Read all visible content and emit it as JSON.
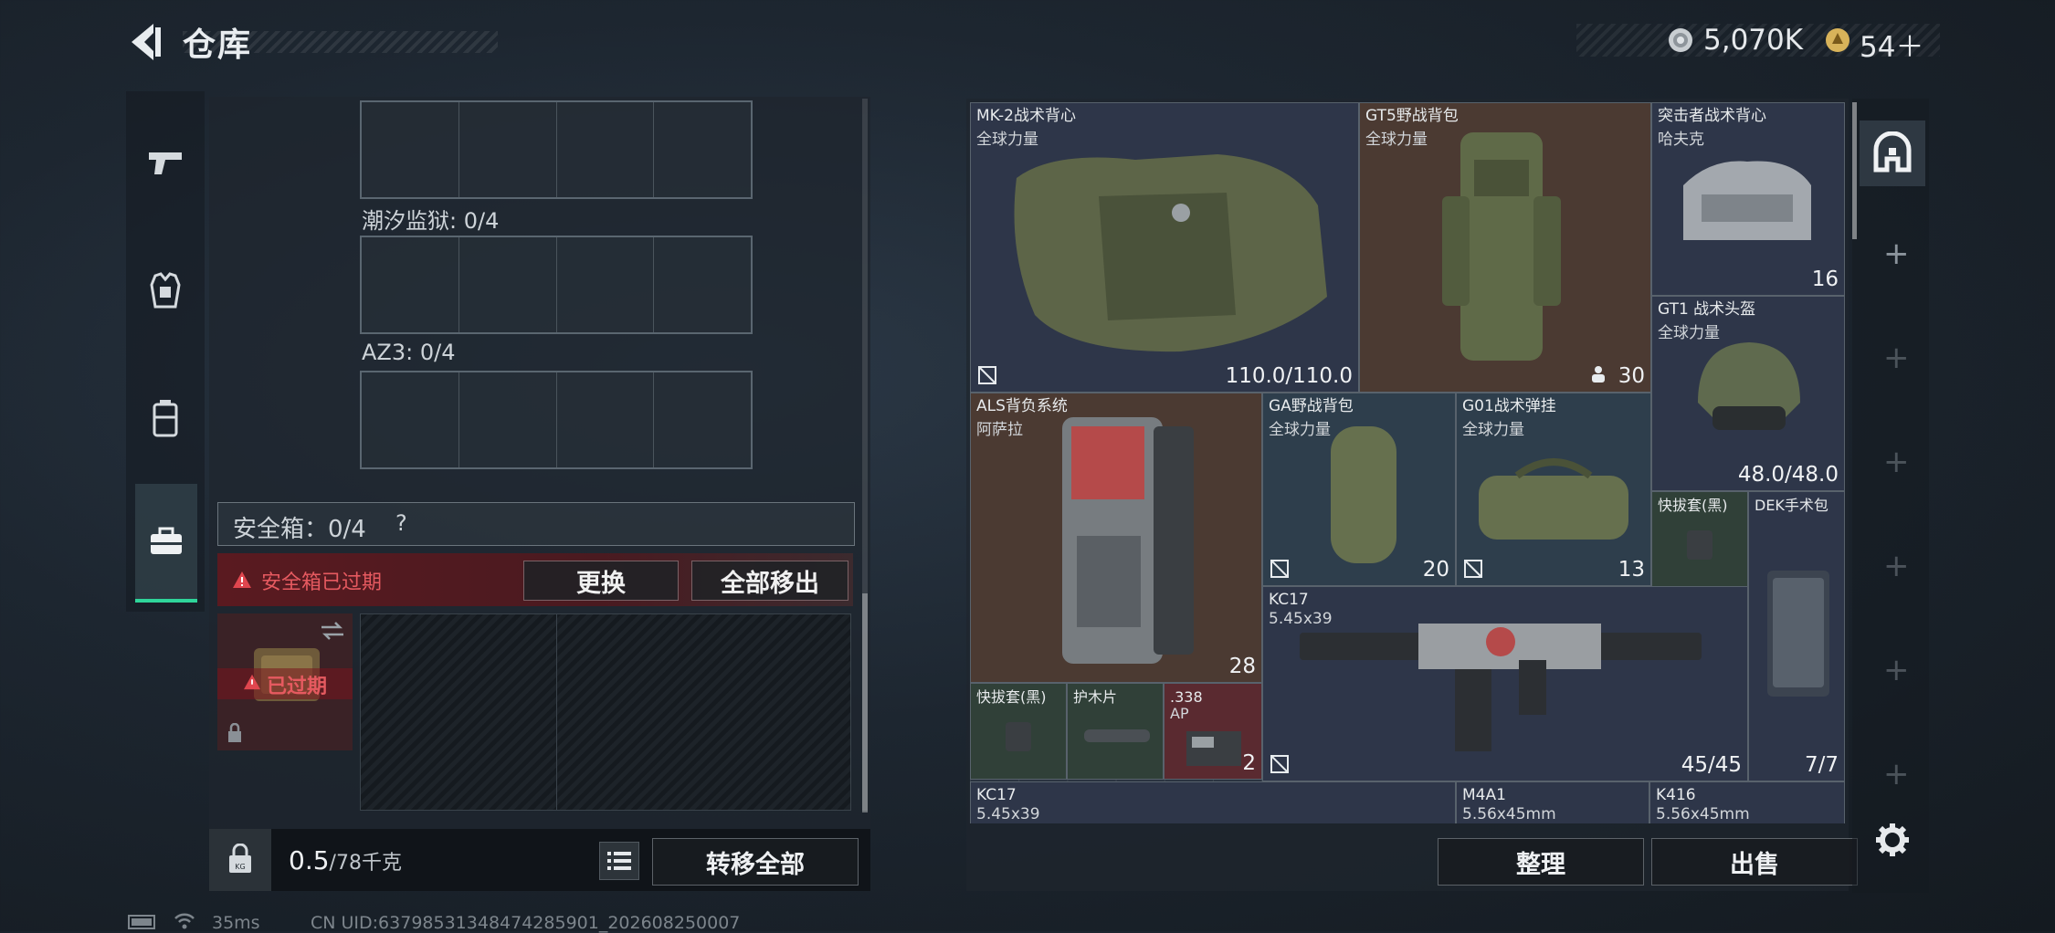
{
  "header": {
    "title": "仓库",
    "currency_silver": "5,070K",
    "currency_gold": "54＋"
  },
  "left_panel": {
    "container_1_label": "潮汐监狱: 0/4",
    "container_2_label": "AZ3: 0/4",
    "safebox_label": "安全箱：0/4",
    "safebox_help": "?",
    "expired_warning": "安全箱已过期",
    "replace_button": "更换",
    "move_all_out_button": "全部移出",
    "expired_badge": "已过期",
    "weight_value": "0.5",
    "weight_max": "/78千克",
    "transfer_all_button": "转移全部"
  },
  "status_bar": {
    "ping": "35ms",
    "uid": "CN UID:637985313484742859​01_202608250007"
  },
  "right_panel": {
    "items": [
      {
        "name": "MK-2战术背心",
        "sub": "全球力量",
        "value": "110.0/110.0"
      },
      {
        "name": "GT5野战背包",
        "sub": "全球力量",
        "value": "30"
      },
      {
        "name": "突击者战术背心",
        "sub": "哈夫克",
        "value": "16"
      },
      {
        "name": "GT1 战术头盔",
        "sub": "全球力量",
        "value": "48.0/48.0"
      },
      {
        "name": "ALS背负系统",
        "sub": "阿萨拉",
        "value": "28"
      },
      {
        "name": "GA野战背包",
        "sub": "全球力量",
        "value": "20"
      },
      {
        "name": "G01战术弹挂",
        "sub": "全球力量",
        "value": "13"
      },
      {
        "name": "快拔套(黑)",
        "sub": "",
        "value": ""
      },
      {
        "name": "DEK手术包",
        "sub": "",
        "value": "7/7"
      },
      {
        "name": "KC17",
        "sub": "5.45x39",
        "value": "45/45"
      },
      {
        "name": "快拔套(黑)",
        "sub": "",
        "value": ""
      },
      {
        "name": "护木片",
        "sub": "",
        "value": ""
      },
      {
        "name": ".338",
        "sub": "AP",
        "value": "2"
      },
      {
        "name": "KC17",
        "sub": "5.45x39",
        "value": ""
      },
      {
        "name": "M4A1",
        "sub": "5.56x45mm",
        "value": ""
      },
      {
        "name": "K416",
        "sub": "5.56x45mm",
        "value": ""
      }
    ],
    "organize_button": "整理",
    "sell_button": "出售"
  },
  "colors": {
    "accent_green": "#2fd59a",
    "warning_red": "#e0464e",
    "panel": "#1e262e"
  }
}
